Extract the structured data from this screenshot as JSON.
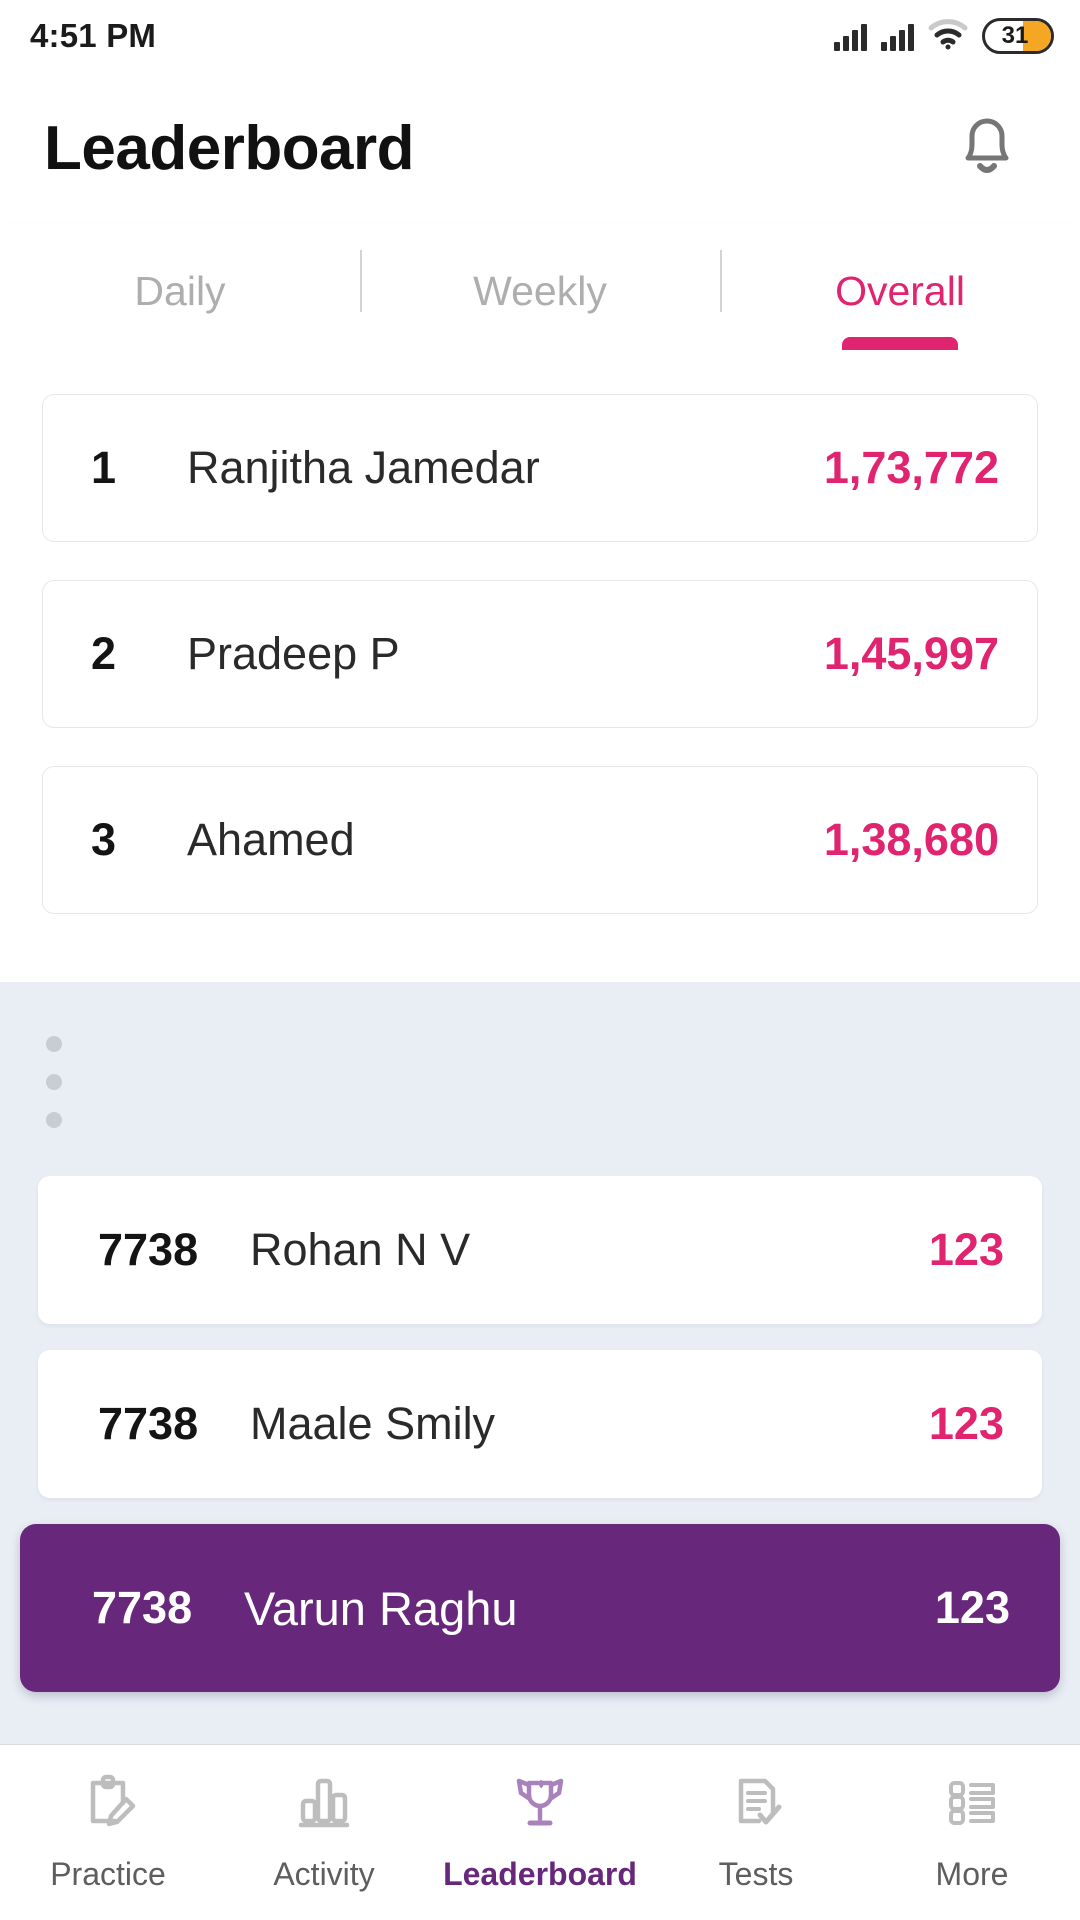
{
  "status_bar": {
    "time": "4:51 PM",
    "battery_level": "31",
    "icons": [
      "signal-bars-icon",
      "signal-bars-icon",
      "wifi-icon",
      "battery-icon"
    ]
  },
  "header": {
    "title": "Leaderboard",
    "notification_icon": "bell-icon"
  },
  "tabs": [
    {
      "label": "Daily",
      "active": false
    },
    {
      "label": "Weekly",
      "active": false
    },
    {
      "label": "Overall",
      "active": true
    }
  ],
  "top_ranks": [
    {
      "rank": "1",
      "name": "Ranjitha Jamedar",
      "score": "1,73,772"
    },
    {
      "rank": "2",
      "name": "Pradeep P",
      "score": "1,45,997"
    },
    {
      "rank": "3",
      "name": "Ahamed",
      "score": "1,38,680"
    }
  ],
  "nearby_ranks": [
    {
      "rank": "7738",
      "name": "Rohan N V",
      "score": "123",
      "is_current_user": false
    },
    {
      "rank": "7738",
      "name": "Maale Smily",
      "score": "123",
      "is_current_user": false
    },
    {
      "rank": "7738",
      "name": "Varun Raghu",
      "score": "123",
      "is_current_user": true
    }
  ],
  "bottom_nav": [
    {
      "label": "Practice",
      "icon": "clipboard-pencil-icon",
      "active": false
    },
    {
      "label": "Activity",
      "icon": "bar-chart-icon",
      "active": false
    },
    {
      "label": "Leaderboard",
      "icon": "trophy-icon",
      "active": true
    },
    {
      "label": "Tests",
      "icon": "document-check-icon",
      "active": false
    },
    {
      "label": "More",
      "icon": "list-icon",
      "active": false
    }
  ],
  "colors": {
    "accent_pink": "#E0246F",
    "accent_purple": "#67277B",
    "nav_active_purple": "#A982BC",
    "page_background": "#E9EEF5",
    "battery_orange": "#F5A623"
  }
}
